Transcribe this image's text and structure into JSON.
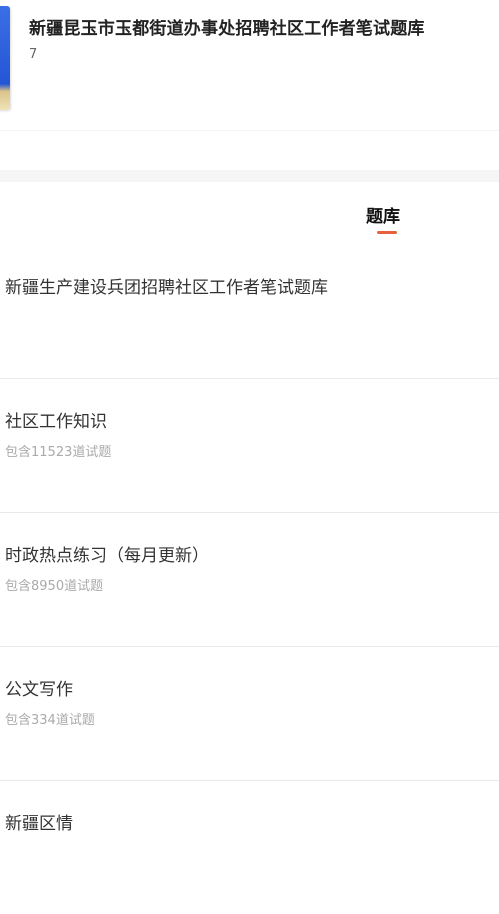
{
  "header": {
    "book_title": "新疆昆玉市玉都街道办事处招聘社区工作者笔试题库",
    "book_count": "7"
  },
  "tabs": {
    "active": "题库",
    "accent_color": "#e8603c"
  },
  "items": [
    {
      "title": "新疆生产建设兵团招聘社区工作者笔试题库",
      "subtitle": ""
    },
    {
      "title": "社区工作知识",
      "subtitle": "包含11523道试题"
    },
    {
      "title": "时政热点练习（每月更新）",
      "subtitle": "包含8950道试题"
    },
    {
      "title": "公文写作",
      "subtitle": "包含334道试题"
    },
    {
      "title": "新疆区情",
      "subtitle": ""
    }
  ]
}
